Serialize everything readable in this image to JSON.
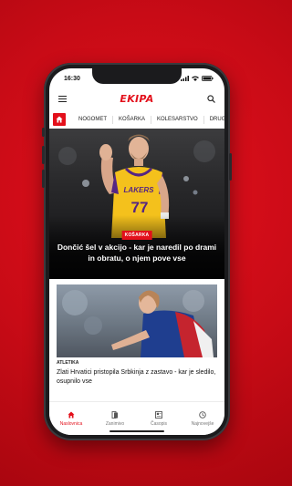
{
  "status_bar": {
    "time": "16:30"
  },
  "header": {
    "logo_text": "EKIPA",
    "menu_icon": "menu-icon",
    "search_icon": "search-icon"
  },
  "nav": {
    "home_icon": "home-icon",
    "items": [
      "NOGOMET",
      "KOŠARKA",
      "KOLESARSTVO",
      "DRUGI ŠPORT"
    ]
  },
  "hero": {
    "category": "KOŠARKA",
    "title": "Dončić šel v akcijo - kar je naredil po drami in obratu, o njem pove vse",
    "jersey_text": "LAKERS",
    "jersey_number": "77"
  },
  "article2": {
    "category": "ATLETIKA",
    "title": "Zlati Hrvatici pristopila Srbkinja z zastavo - kar je sledilo, osupnilo vse"
  },
  "bottom_nav": [
    {
      "label": "Naslovnica",
      "icon": "home-icon",
      "active": true
    },
    {
      "label": "Zanimivo",
      "icon": "bookmark-icon",
      "active": false
    },
    {
      "label": "Časopis",
      "icon": "newspaper-icon",
      "active": false
    },
    {
      "label": "Najnovejše",
      "icon": "clock-icon",
      "active": false
    }
  ],
  "colors": {
    "brand_red": "#e3101b",
    "background_red": "#c80b16"
  }
}
